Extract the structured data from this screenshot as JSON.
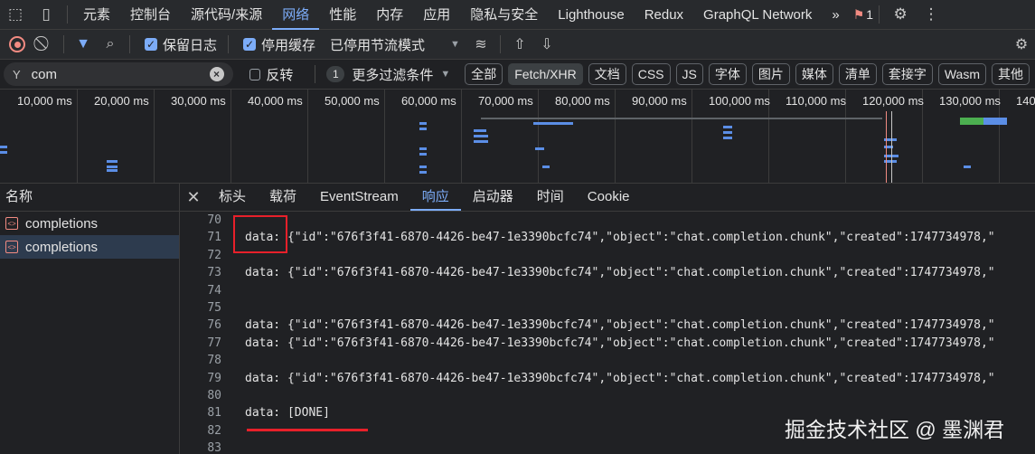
{
  "top_tabs": [
    "元素",
    "控制台",
    "源代码/来源",
    "网络",
    "性能",
    "内存",
    "应用",
    "隐私与安全",
    "Lighthouse",
    "Redux",
    "GraphQL Network"
  ],
  "active_top_tab": "网络",
  "more_tabs": "»",
  "issues_count": "1",
  "toolbar": {
    "preserve_log": "保留日志",
    "disable_cache": "停用缓存",
    "throttling": "已停用节流模式"
  },
  "filter": {
    "value": "com",
    "invert_label": "反转",
    "more_filters_count": "1",
    "more_filters_label": "更多过滤条件",
    "types": [
      "全部",
      "Fetch/XHR",
      "文档",
      "CSS",
      "JS",
      "字体",
      "图片",
      "媒体",
      "清单",
      "套接字",
      "Wasm",
      "其他"
    ],
    "active_type": "Fetch/XHR"
  },
  "timeline": {
    "ticks": [
      "10,000 ms",
      "20,000 ms",
      "30,000 ms",
      "40,000 ms",
      "50,000 ms",
      "60,000 ms",
      "70,000 ms",
      "80,000 ms",
      "90,000 ms",
      "100,000 ms",
      "110,000 ms",
      "120,000 ms",
      "130,000 ms",
      "140,"
    ]
  },
  "requests": {
    "header": "名称",
    "items": [
      {
        "name": "completions",
        "selected": false
      },
      {
        "name": "completions",
        "selected": true
      }
    ]
  },
  "detail_tabs": [
    "标头",
    "载荷",
    "EventStream",
    "响应",
    "启动器",
    "时间",
    "Cookie"
  ],
  "active_detail_tab": "响应",
  "response_lines": [
    {
      "n": "70",
      "text": ""
    },
    {
      "n": "71",
      "text": "data: {\"id\":\"676f3f41-6870-4426-be47-1e3390bcfc74\",\"object\":\"chat.completion.chunk\",\"created\":1747734978,\""
    },
    {
      "n": "72",
      "text": ""
    },
    {
      "n": "73",
      "text": "data: {\"id\":\"676f3f41-6870-4426-be47-1e3390bcfc74\",\"object\":\"chat.completion.chunk\",\"created\":1747734978,\""
    },
    {
      "n": "74",
      "text": ""
    },
    {
      "n": "75",
      "text": ""
    },
    {
      "n": "76",
      "text": "data: {\"id\":\"676f3f41-6870-4426-be47-1e3390bcfc74\",\"object\":\"chat.completion.chunk\",\"created\":1747734978,\""
    },
    {
      "n": "77",
      "text": "data: {\"id\":\"676f3f41-6870-4426-be47-1e3390bcfc74\",\"object\":\"chat.completion.chunk\",\"created\":1747734978,\""
    },
    {
      "n": "78",
      "text": ""
    },
    {
      "n": "79",
      "text": "data: {\"id\":\"676f3f41-6870-4426-be47-1e3390bcfc74\",\"object\":\"chat.completion.chunk\",\"created\":1747734978,\""
    },
    {
      "n": "80",
      "text": ""
    },
    {
      "n": "81",
      "text": "data: [DONE]"
    },
    {
      "n": "82",
      "text": ""
    },
    {
      "n": "83",
      "text": ""
    }
  ],
  "watermark": "掘金技术社区 @ 墨渊君",
  "colors": {
    "accent": "#7cacf8",
    "highlight": "#e8202a",
    "bg": "#202124"
  }
}
